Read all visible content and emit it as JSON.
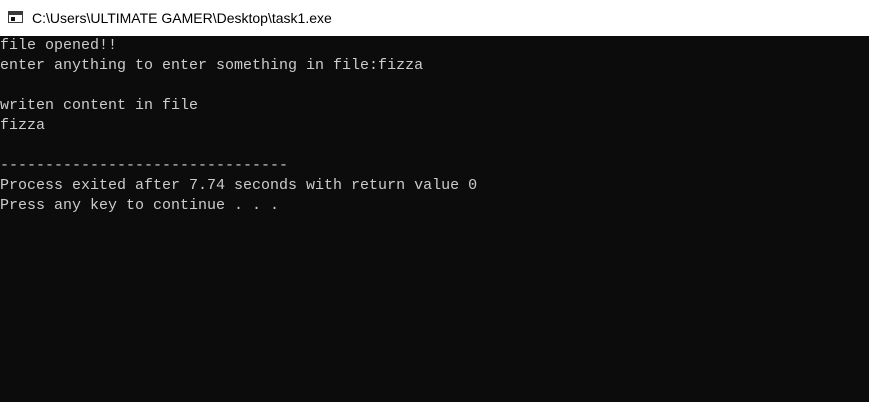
{
  "window": {
    "title": "C:\\Users\\ULTIMATE GAMER\\Desktop\\task1.exe",
    "icon": "console-app-icon"
  },
  "console": {
    "lines": [
      "file opened!!",
      "enter anything to enter something in file:fizza",
      "",
      "writen content in file",
      "fizza",
      "",
      "--------------------------------",
      "Process exited after 7.74 seconds with return value 0",
      "Press any key to continue . . ."
    ]
  },
  "colors": {
    "console_background": "#0c0c0c",
    "console_text": "#cccccc",
    "titlebar_background": "#ffffff"
  }
}
